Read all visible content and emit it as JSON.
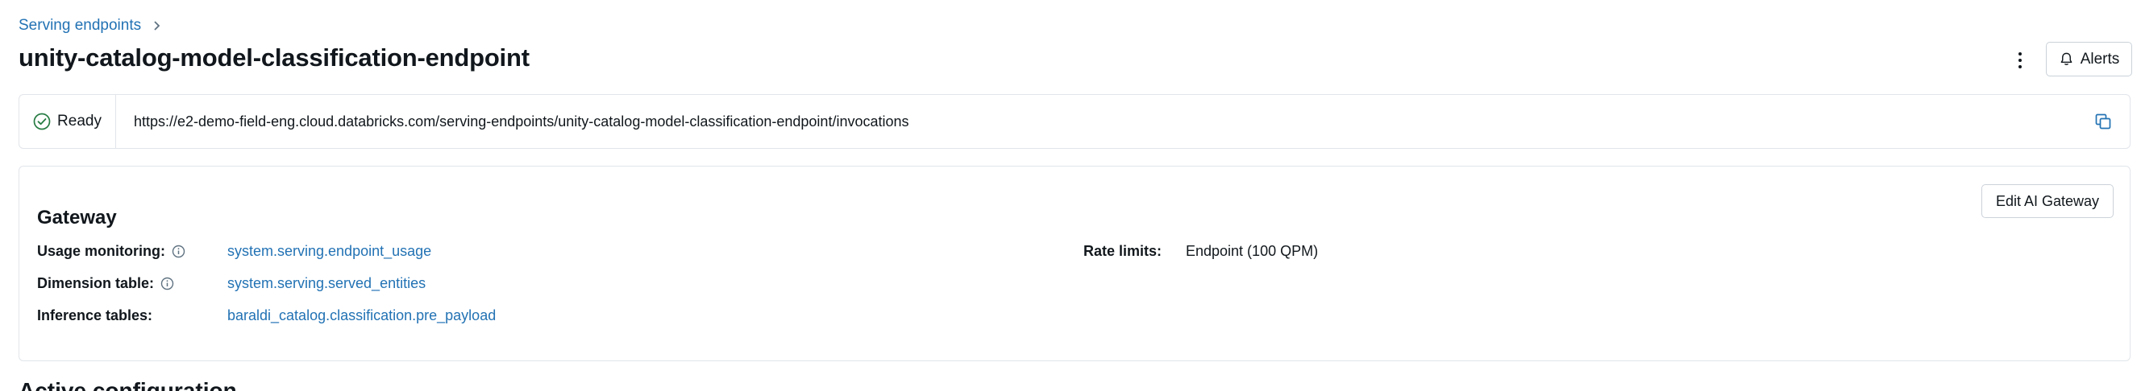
{
  "breadcrumb": {
    "label": "Serving endpoints"
  },
  "page_title": "unity-catalog-model-classification-endpoint",
  "header": {
    "alerts_label": "Alerts"
  },
  "endpoint": {
    "status": "Ready",
    "url": "https://e2-demo-field-eng.cloud.databricks.com/serving-endpoints/unity-catalog-model-classification-endpoint/invocations"
  },
  "gateway": {
    "title": "Gateway",
    "edit_label": "Edit AI Gateway",
    "usage_monitoring": {
      "label": "Usage monitoring:",
      "value": "system.serving.endpoint_usage"
    },
    "dimension_table": {
      "label": "Dimension table:",
      "value": "system.serving.served_entities"
    },
    "inference_tables": {
      "label": "Inference tables:",
      "value": "baraldi_catalog.classification.pre_payload"
    },
    "rate_limits": {
      "label": "Rate limits:",
      "value": "Endpoint (100 QPM)"
    }
  },
  "next_section_title": "Active configuration",
  "colors": {
    "link": "#2272b4",
    "success": "#277c43",
    "border": "#e1e5ea"
  },
  "icons": [
    "chevron-right-icon",
    "kebab-menu-icon",
    "bell-icon",
    "check-circle-icon",
    "copy-icon",
    "info-icon"
  ]
}
